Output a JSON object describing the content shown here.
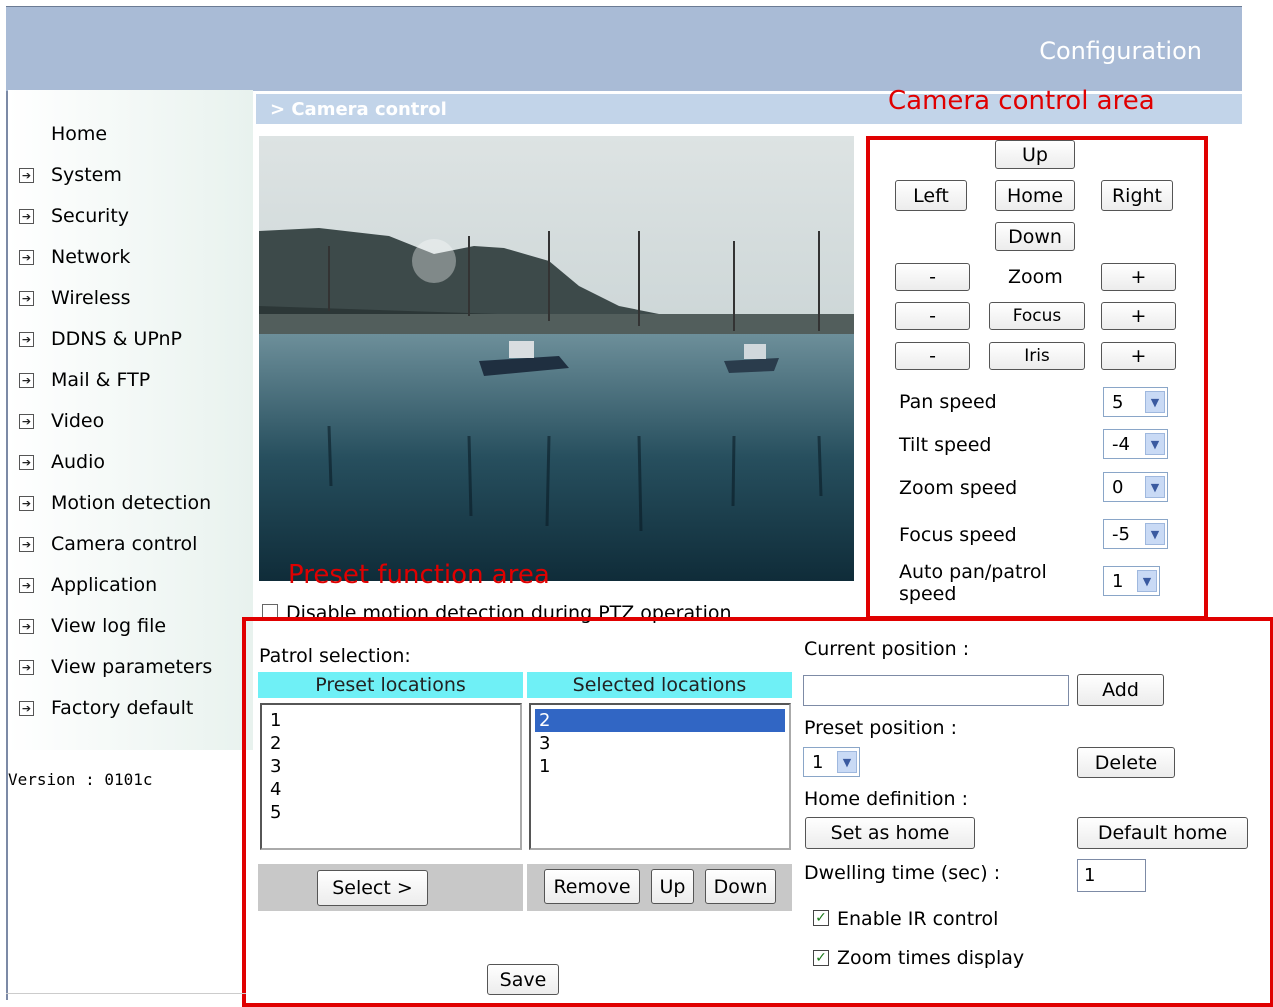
{
  "header": {
    "title": "Configuration"
  },
  "sidebar": {
    "items": [
      {
        "label": "Home",
        "icon": false
      },
      {
        "label": "System",
        "icon": true
      },
      {
        "label": "Security",
        "icon": true
      },
      {
        "label": "Network",
        "icon": true
      },
      {
        "label": "Wireless",
        "icon": true
      },
      {
        "label": "DDNS & UPnP",
        "icon": true
      },
      {
        "label": "Mail & FTP",
        "icon": true
      },
      {
        "label": "Video",
        "icon": true
      },
      {
        "label": "Audio",
        "icon": true
      },
      {
        "label": "Motion detection",
        "icon": true
      },
      {
        "label": "Camera control",
        "icon": true
      },
      {
        "label": "Application",
        "icon": true
      },
      {
        "label": "View log file",
        "icon": true
      },
      {
        "label": "View parameters",
        "icon": true
      },
      {
        "label": "Factory default",
        "icon": true
      }
    ],
    "version": "Version : 0101c"
  },
  "page": {
    "breadcrumb": "> Camera control"
  },
  "annotations": {
    "camera_area": "Camera control area",
    "preset_area": "Preset function area"
  },
  "camera": {
    "up": "Up",
    "left": "Left",
    "home": "Home",
    "right": "Right",
    "down": "Down",
    "minus": "-",
    "plus": "+",
    "zoom": "Zoom",
    "focus": "Focus",
    "iris": "Iris",
    "pan_speed_label": "Pan speed",
    "pan_speed_value": "5",
    "tilt_speed_label": "Tilt speed",
    "tilt_speed_value": "-4",
    "zoom_speed_label": "Zoom speed",
    "zoom_speed_value": "0",
    "focus_speed_label": "Focus speed",
    "focus_speed_value": "-5",
    "auto_pan_label_1": "Auto pan/patrol",
    "auto_pan_label_2": "speed",
    "auto_pan_value": "1"
  },
  "motion": {
    "disable_label": "Disable motion detection during PTZ operation"
  },
  "preset": {
    "patrol_selection_label": "Patrol selection:",
    "preset_locations_header": "Preset locations",
    "selected_locations_header": "Selected locations",
    "preset_locations": [
      "1",
      "2",
      "3",
      "4",
      "5"
    ],
    "selected_locations": [
      "2",
      "3",
      "1"
    ],
    "select_button": "Select >",
    "remove_button": "Remove",
    "up_button": "Up",
    "down_button": "Down",
    "save_button": "Save",
    "current_position_label": "Current position :",
    "current_position_value": "",
    "add_button": "Add",
    "preset_position_label": "Preset position :",
    "preset_position_value": "1",
    "delete_button": "Delete",
    "home_definition_label": "Home definition :",
    "set_as_home_button": "Set as home",
    "default_home_button": "Default home",
    "dwelling_label": "Dwelling time (sec) :",
    "dwelling_value": "1",
    "enable_ir_label": "Enable IR control",
    "enable_ir_checked": true,
    "zoom_times_label": "Zoom times display",
    "zoom_times_checked": true
  }
}
